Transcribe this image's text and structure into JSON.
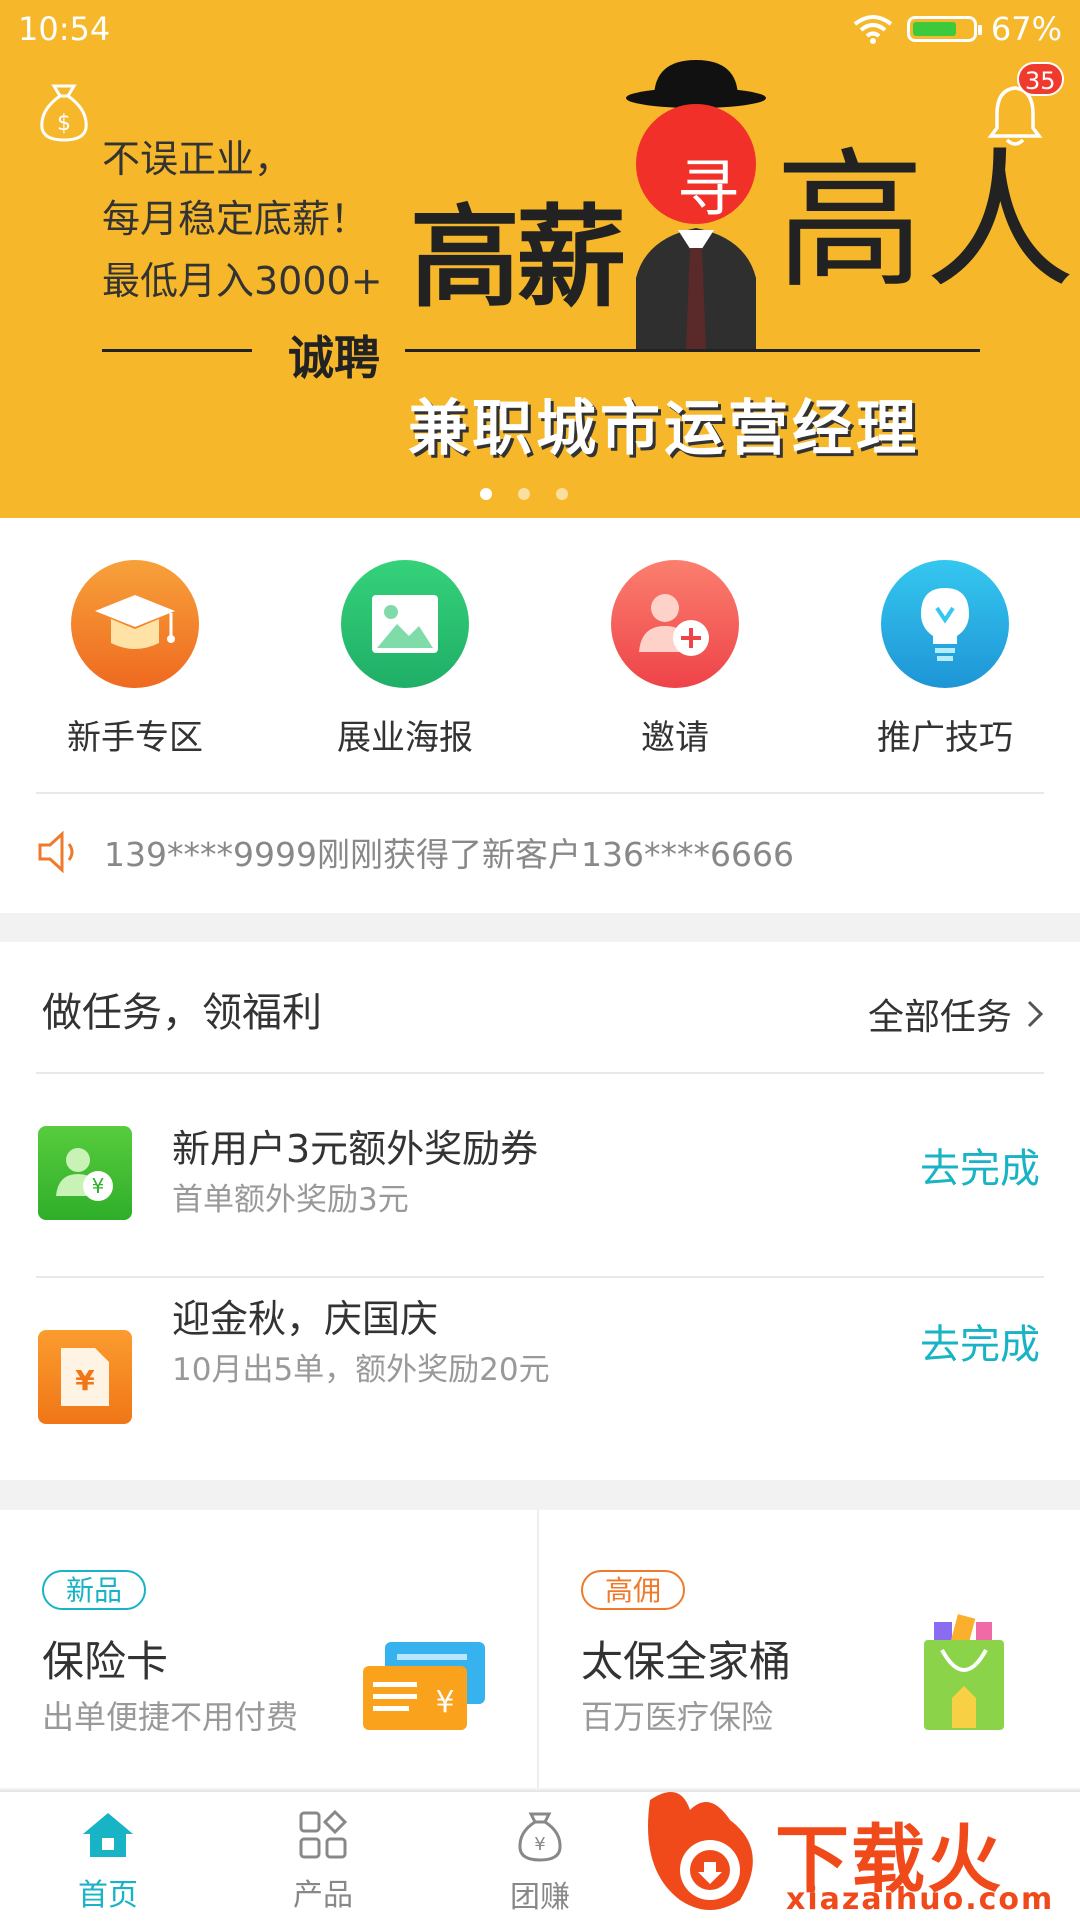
{
  "status_bar": {
    "time": "10:54",
    "battery": "67%"
  },
  "header": {
    "notification_count": "35"
  },
  "banner": {
    "lines": [
      "不误正业，",
      "每月稳定底薪！",
      "最低月入3000+"
    ],
    "headline_left": "高薪",
    "headline_right": "高人",
    "hiring": "诚聘",
    "position": "兼职城市运营经理",
    "badge_char": "寻",
    "page_count": 3,
    "active_page": 1
  },
  "quick_entries": [
    {
      "label": "新手专区",
      "icon": "graduation-cap-icon"
    },
    {
      "label": "展业海报",
      "icon": "image-icon"
    },
    {
      "label": "邀请",
      "icon": "add-user-icon"
    },
    {
      "label": "推广技巧",
      "icon": "lightbulb-icon"
    }
  ],
  "notice": {
    "text": "139****9999刚刚获得了新客户136****6666",
    "icon": "speaker-icon"
  },
  "tasks": {
    "title": "做任务，领福利",
    "all_label": "全部任务",
    "items": [
      {
        "title": "新用户3元额外奖励券",
        "subtitle": "首单额外奖励3元",
        "action": "去完成",
        "icon": "user-yuan-icon"
      },
      {
        "title": "迎金秋，庆国庆",
        "subtitle": "10月出5单，额外奖励20元",
        "action": "去完成",
        "icon": "yuan-document-icon"
      }
    ]
  },
  "products": [
    {
      "tag": "新品",
      "title": "保险卡",
      "subtitle": "出单便捷不用付费",
      "icon": "card-icon"
    },
    {
      "tag": "高佣",
      "title": "太保全家桶",
      "subtitle": "百万医疗保险",
      "icon": "shopping-bag-icon"
    }
  ],
  "tabbar": [
    {
      "label": "首页",
      "active": true
    },
    {
      "label": "产品",
      "active": false
    },
    {
      "label": "团赚",
      "active": false
    }
  ],
  "watermark": {
    "text": "下载火",
    "url": "xiazaihuo.com"
  },
  "colors": {
    "banner": "#f6b82a",
    "accent": "#18b3c4",
    "badge": "#f03a2e"
  }
}
